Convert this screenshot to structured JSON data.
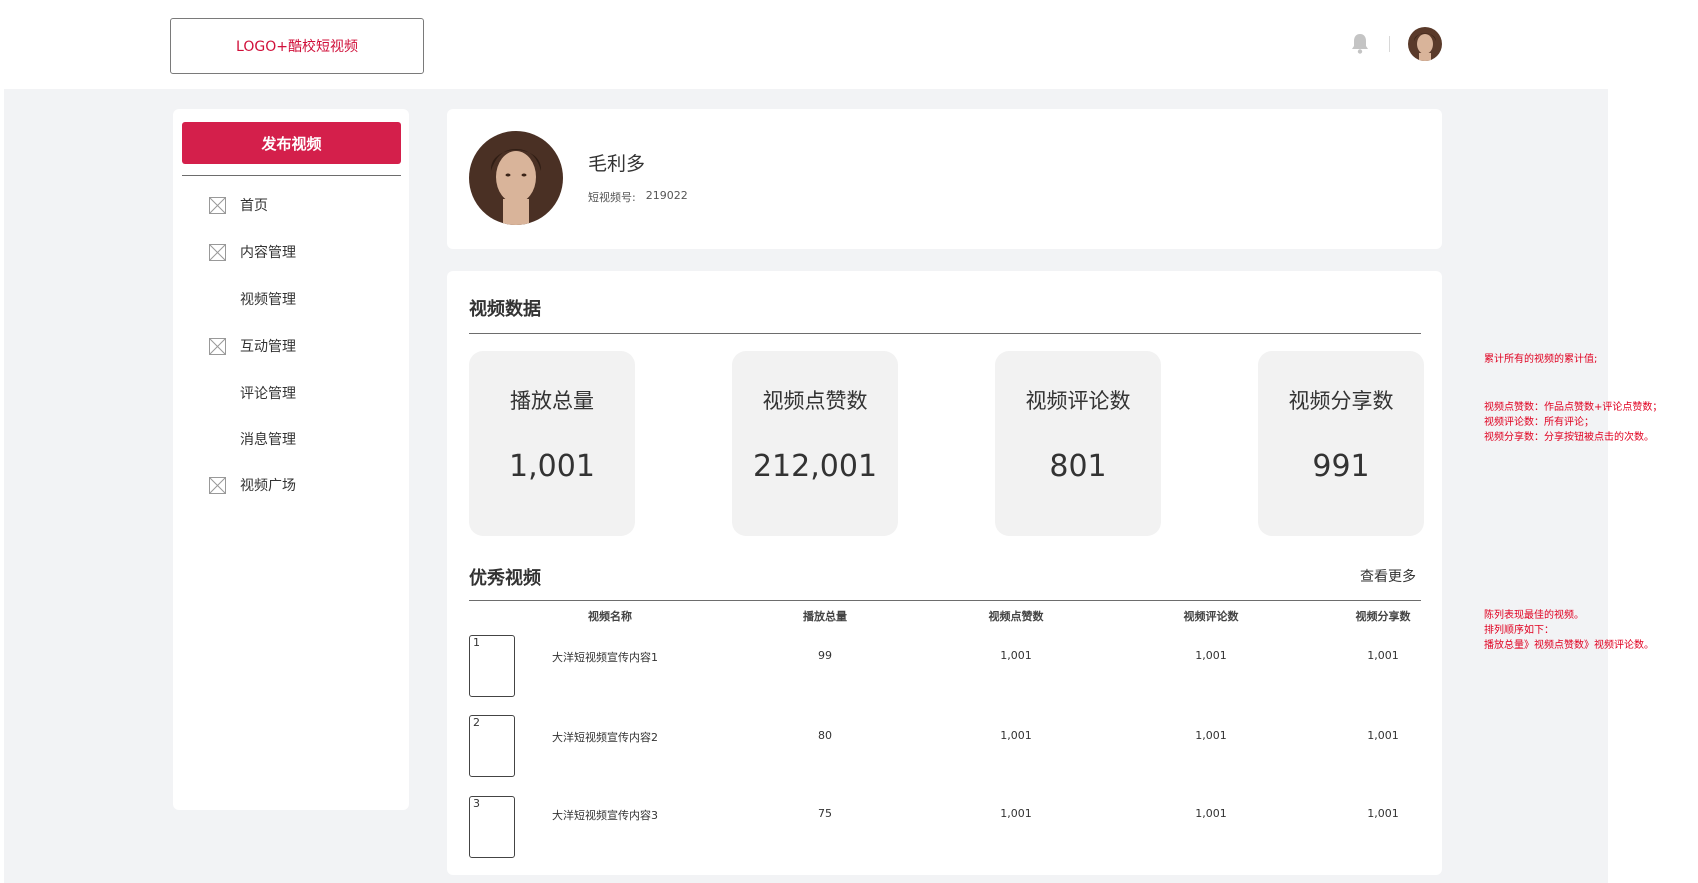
{
  "header": {
    "logo_text": "LOGO+酷校短视频"
  },
  "sidebar": {
    "publish_label": "发布视频",
    "items": [
      {
        "label": "首页",
        "icon": "placeholder-x-icon"
      },
      {
        "label": "内容管理",
        "icon": "placeholder-x-icon"
      },
      {
        "label": "视频管理"
      },
      {
        "label": "互动管理",
        "icon": "placeholder-x-icon"
      },
      {
        "label": "评论管理"
      },
      {
        "label": "消息管理"
      },
      {
        "label": "视频广场",
        "icon": "placeholder-x-icon"
      }
    ]
  },
  "profile": {
    "name": "毛利多",
    "id_label": "短视频号:",
    "id_value": "219022"
  },
  "video_data": {
    "title": "视频数据",
    "stats": [
      {
        "label": "播放总量",
        "value": "1,001"
      },
      {
        "label": "视频点赞数",
        "value": "212,001"
      },
      {
        "label": "视频评论数",
        "value": "801"
      },
      {
        "label": "视频分享数",
        "value": "991"
      }
    ]
  },
  "top_videos": {
    "title": "优秀视频",
    "more_label": "查看更多",
    "columns": [
      "视频名称",
      "播放总量",
      "视频点赞数",
      "视频评论数",
      "视频分享数"
    ],
    "rows": [
      {
        "rank": "1",
        "name": "大洋短视频宣传内容1",
        "plays": "99",
        "likes": "1,001",
        "comments": "1,001",
        "shares": "1,001"
      },
      {
        "rank": "2",
        "name": "大洋短视频宣传内容2",
        "plays": "80",
        "likes": "1,001",
        "comments": "1,001",
        "shares": "1,001"
      },
      {
        "rank": "3",
        "name": "大洋短视频宣传内容3",
        "plays": "75",
        "likes": "1,001",
        "comments": "1,001",
        "shares": "1,001"
      }
    ]
  },
  "annotations": {
    "note1": "累计所有的视频的累计值;",
    "note2_lines": [
      "视频点赞数：作品点赞数+评论点赞数；",
      "视频评论数：所有评论；",
      "视频分享数：分享按钮被点击的次数。"
    ],
    "note3_lines": [
      "陈列表现最佳的视频。",
      "排列顺序如下：",
      "播放总量》视频点赞数》视频评论数。"
    ]
  },
  "colors": {
    "accent": "#d41f4b",
    "annotation": "#e00020",
    "page_bg": "#f2f3f5"
  }
}
